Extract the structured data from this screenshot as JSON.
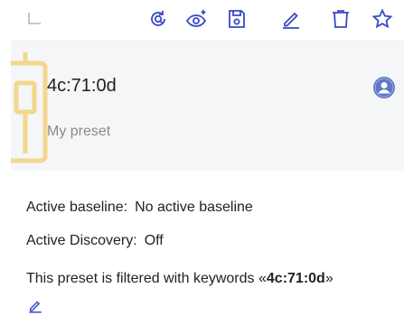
{
  "toolbar": {
    "icons": [
      "undo-icon",
      "refresh-search-icon",
      "eye-sparkle-icon",
      "save-icon",
      "edit-icon",
      "delete-icon",
      "star-icon"
    ],
    "accent_color": "#3a49c4",
    "disabled_color": "#b5b5b5"
  },
  "card": {
    "title": "4c:71:0d",
    "preset_name": "My preset",
    "watermark_color": "#f3d27a",
    "avatar_color": "#5e78c6"
  },
  "details": {
    "active_baseline_label": "Active baseline:",
    "active_baseline_value": "No active baseline",
    "active_discovery_label": "Active Discovery:",
    "active_discovery_value": "Off",
    "filter_prefix": "This preset is filtered with keywords ",
    "filter_open_quote": "«",
    "filter_keyword": "4c:71:0d",
    "filter_close_quote": "»"
  }
}
